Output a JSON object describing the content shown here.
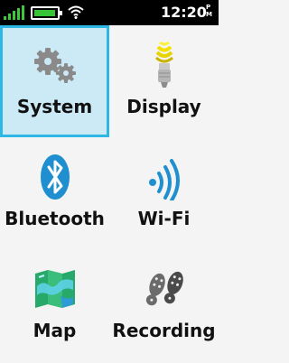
{
  "status_bar": {
    "time": "12:20",
    "ampm": "P\nM",
    "icons": [
      "signal-icon",
      "battery-icon",
      "wifi-icon"
    ],
    "colors": {
      "background": "#000000",
      "signal": "#3bc93b",
      "battery": "#37c337"
    }
  },
  "menu": {
    "selected": "system",
    "items": [
      {
        "id": "system",
        "label": "System",
        "icon": "gears-icon"
      },
      {
        "id": "display",
        "label": "Display",
        "icon": "light-bulb-icon"
      },
      {
        "id": "bluetooth",
        "label": "Bluetooth",
        "icon": "bluetooth-icon"
      },
      {
        "id": "wifi",
        "label": "Wi-Fi",
        "icon": "wifi-icon"
      },
      {
        "id": "map",
        "label": "Map",
        "icon": "map-icon"
      },
      {
        "id": "recording",
        "label": "Recording",
        "icon": "footprints-icon"
      }
    ],
    "colors": {
      "selected_bg": "#cbeaf6",
      "selected_border": "#2db7e4",
      "background": "#f4f4f4"
    }
  }
}
